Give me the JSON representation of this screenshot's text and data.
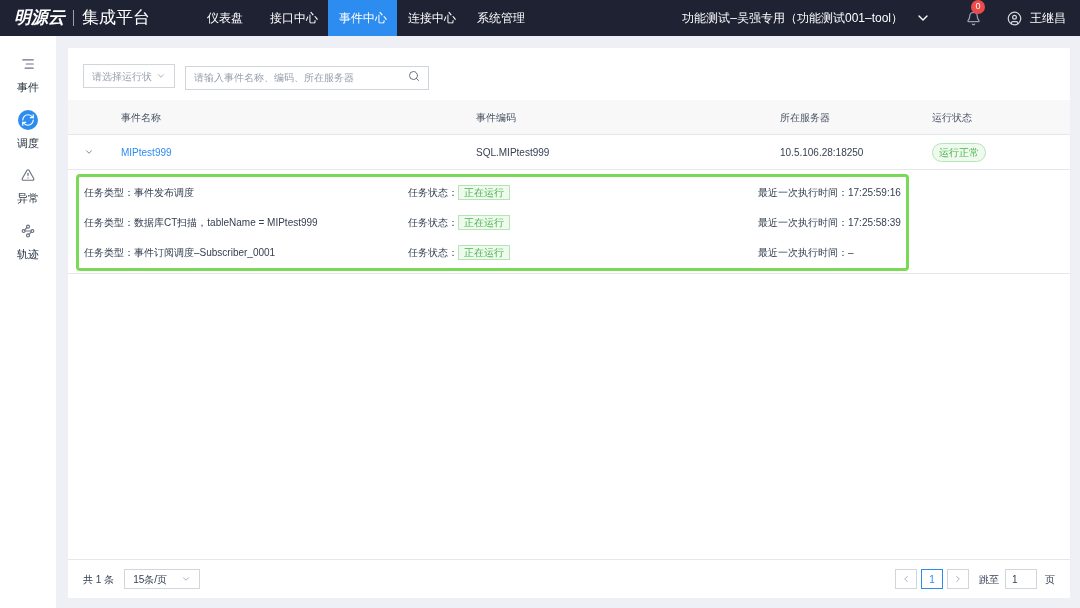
{
  "header": {
    "logo": "明源云",
    "product": "集成平台",
    "nav": [
      {
        "label": "仪表盘",
        "selected": false
      },
      {
        "label": "接口中心",
        "selected": false
      },
      {
        "label": "事件中心",
        "selected": true
      },
      {
        "label": "连接中心",
        "selected": false
      },
      {
        "label": "系统管理",
        "selected": false
      }
    ],
    "tenant": "功能测试–吴强专用（功能测试001–tool）",
    "notifications": "0",
    "user": "王继昌"
  },
  "sidebar": {
    "items": [
      {
        "label": "事件",
        "kind": "list",
        "selected": false
      },
      {
        "label": "调度",
        "kind": "schedule",
        "selected": true
      },
      {
        "label": "异常",
        "kind": "warning",
        "selected": false
      },
      {
        "label": "轨迹",
        "kind": "track",
        "selected": false
      }
    ]
  },
  "filters": {
    "status": {
      "placeholder": "请选择运行状"
    },
    "search": {
      "placeholder": "请输入事件名称、编码、所在服务器"
    }
  },
  "table": {
    "columns": [
      "事件名称",
      "事件编码",
      "所在服务器",
      "运行状态"
    ],
    "rows": [
      {
        "name": "MIPtest999",
        "code": "SQL.MIPtest999",
        "server": "10.5.106.28:18250",
        "status": "运行正常",
        "expanded": true,
        "tasks": [
          {
            "type_label": "任务类型：",
            "type": "事件发布调度",
            "state_label": "任务状态：",
            "state": "正在运行",
            "time_label": "最近一次执行时间：",
            "time": "17:25:59:16"
          },
          {
            "type_label": "任务类型：",
            "type": "数据库CT扫描，tableName = MIPtest999",
            "state_label": "任务状态：",
            "state": "正在运行",
            "time_label": "最近一次执行时间：",
            "time": "17:25:58:39"
          },
          {
            "type_label": "任务类型：",
            "type": "事件订阅调度–Subscriber_0001",
            "state_label": "任务状态：",
            "state": "正在运行",
            "time_label": "最近一次执行时间：",
            "time": "–"
          }
        ]
      }
    ]
  },
  "footer": {
    "total": "共 1 条",
    "page_size": "15条/页",
    "pages": [
      {
        "label": "1",
        "selected": true
      }
    ],
    "jump_label": "跳至",
    "jump_value": "1",
    "jump_suffix": "页"
  }
}
